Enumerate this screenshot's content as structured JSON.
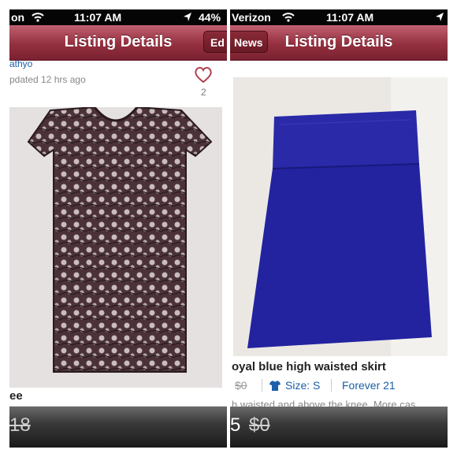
{
  "left": {
    "status": {
      "carrier": "on",
      "time": "11:07 AM",
      "battery": "44%"
    },
    "nav": {
      "title": "Listing Details",
      "right_button": "Ed"
    },
    "seller": {
      "name": "athyo",
      "updated": "pdated 12 hrs ago"
    },
    "likes": "2",
    "title_fragment": "ee",
    "price_fragment": "18"
  },
  "right": {
    "status": {
      "carrier": "Verizon",
      "time": "11:07 AM"
    },
    "nav": {
      "title": "Listing Details",
      "left_button": "News"
    },
    "listing": {
      "title": "oyal blue high waisted skirt",
      "original_price": "$0",
      "size": "Size: S",
      "brand": "Forever 21",
      "description": "h waisted and above the knee. More cas"
    },
    "price_fragment": "5",
    "original_price_bottom": "$0"
  },
  "colors": {
    "nav_bar": "#94303f",
    "link": "#1b5fa8",
    "skirt": "#2727a6",
    "lace": "#3a2a30"
  }
}
